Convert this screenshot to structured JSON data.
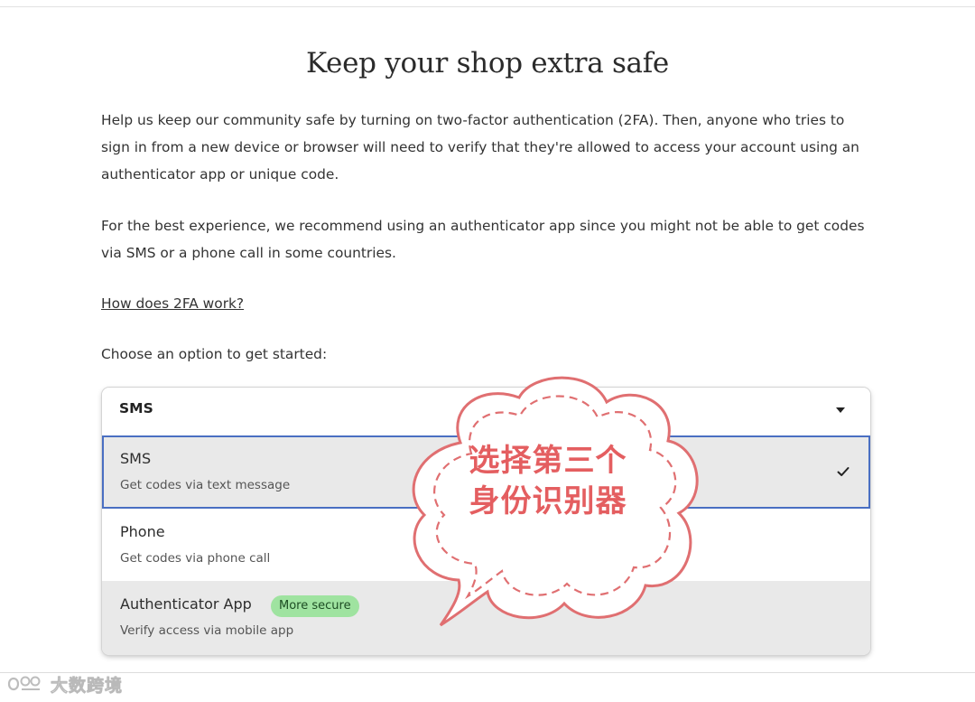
{
  "page": {
    "title": "Keep your shop extra safe",
    "paragraph_1": "Help us keep our community safe by turning on two-factor authentication (2FA). Then, anyone who tries to sign in from a new device or browser will need to verify that they're allowed to access your account using an authenticator app or unique code.",
    "paragraph_2": "For the best experience, we recommend using an authenticator app since you might not be able to get codes via SMS or a phone call in some countries.",
    "help_link": "How does 2FA work?",
    "choose_label": "Choose an option to get started:"
  },
  "dropdown": {
    "selected_value": "SMS",
    "caret_icon": "caret-down-icon",
    "options": [
      {
        "title": "SMS",
        "description": "Get codes via text message",
        "selected": true,
        "icon": "check-icon"
      },
      {
        "title": "Phone",
        "description": "Get codes via phone call",
        "selected": false
      },
      {
        "title": "Authenticator App",
        "description": "Verify access via mobile app",
        "badge": "More secure",
        "selected": false
      }
    ]
  },
  "annotation": {
    "text": "选择第三个身份识别器",
    "color": "#e45e60"
  },
  "watermark": {
    "text": "大数跨境",
    "icon": "logo-icon"
  },
  "colors": {
    "highlight_border": "#4a6fc2",
    "badge_bg": "#9fe3a0",
    "option_bg": "#e9e9e9"
  }
}
